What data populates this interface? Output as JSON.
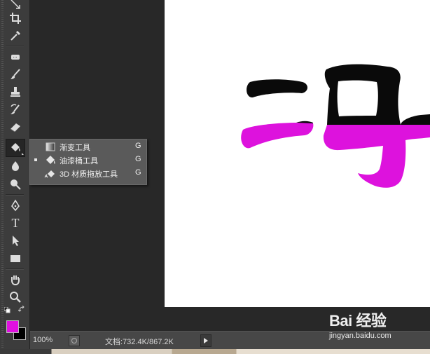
{
  "colors": {
    "foreground": "#e010e0",
    "background": "#000000",
    "paint_black": "#0a0a0a",
    "paint_magenta": "#dd12dd"
  },
  "toolbar": {
    "tools": [
      {
        "name": "move-tool",
        "icon": "move-icon"
      },
      {
        "name": "crop-tool",
        "icon": "crop-icon"
      },
      {
        "name": "eyedropper-tool",
        "icon": "eyedropper-icon"
      },
      {
        "name": "spot-healing-tool",
        "icon": "bandage-icon"
      },
      {
        "name": "brush-tool",
        "icon": "brush-icon"
      },
      {
        "name": "clone-stamp-tool",
        "icon": "stamp-icon"
      },
      {
        "name": "history-brush-tool",
        "icon": "history-brush-icon"
      },
      {
        "name": "eraser-tool",
        "icon": "eraser-icon"
      },
      {
        "name": "paint-bucket-tool",
        "icon": "paint-bucket-icon"
      },
      {
        "name": "blur-tool",
        "icon": "blur-icon"
      },
      {
        "name": "dodge-tool",
        "icon": "dodge-icon"
      },
      {
        "name": "pen-tool",
        "icon": "pen-icon"
      },
      {
        "name": "type-tool",
        "icon": "type-icon"
      },
      {
        "name": "path-selection-tool",
        "icon": "arrow-icon"
      },
      {
        "name": "rectangle-tool",
        "icon": "rectangle-icon"
      },
      {
        "name": "hand-tool",
        "icon": "hand-icon"
      },
      {
        "name": "zoom-tool",
        "icon": "zoom-icon"
      }
    ],
    "active_tool": "paint-bucket-tool",
    "type_glyph": "T"
  },
  "flyout": {
    "items": [
      {
        "label": "渐变工具",
        "shortcut": "G",
        "icon": "gradient-icon",
        "selected": false
      },
      {
        "label": "油漆桶工具",
        "shortcut": "G",
        "icon": "paint-bucket-icon",
        "selected": true
      },
      {
        "label": "3D 材质拖放工具",
        "shortcut": "G",
        "icon": "material-drop-icon",
        "selected": false
      }
    ]
  },
  "status": {
    "zoom": "100%",
    "doc_size": "文档:732.4K/867.2K"
  },
  "watermark": {
    "brand": "Bai 经验",
    "url": "jingyan.baidu.com"
  }
}
